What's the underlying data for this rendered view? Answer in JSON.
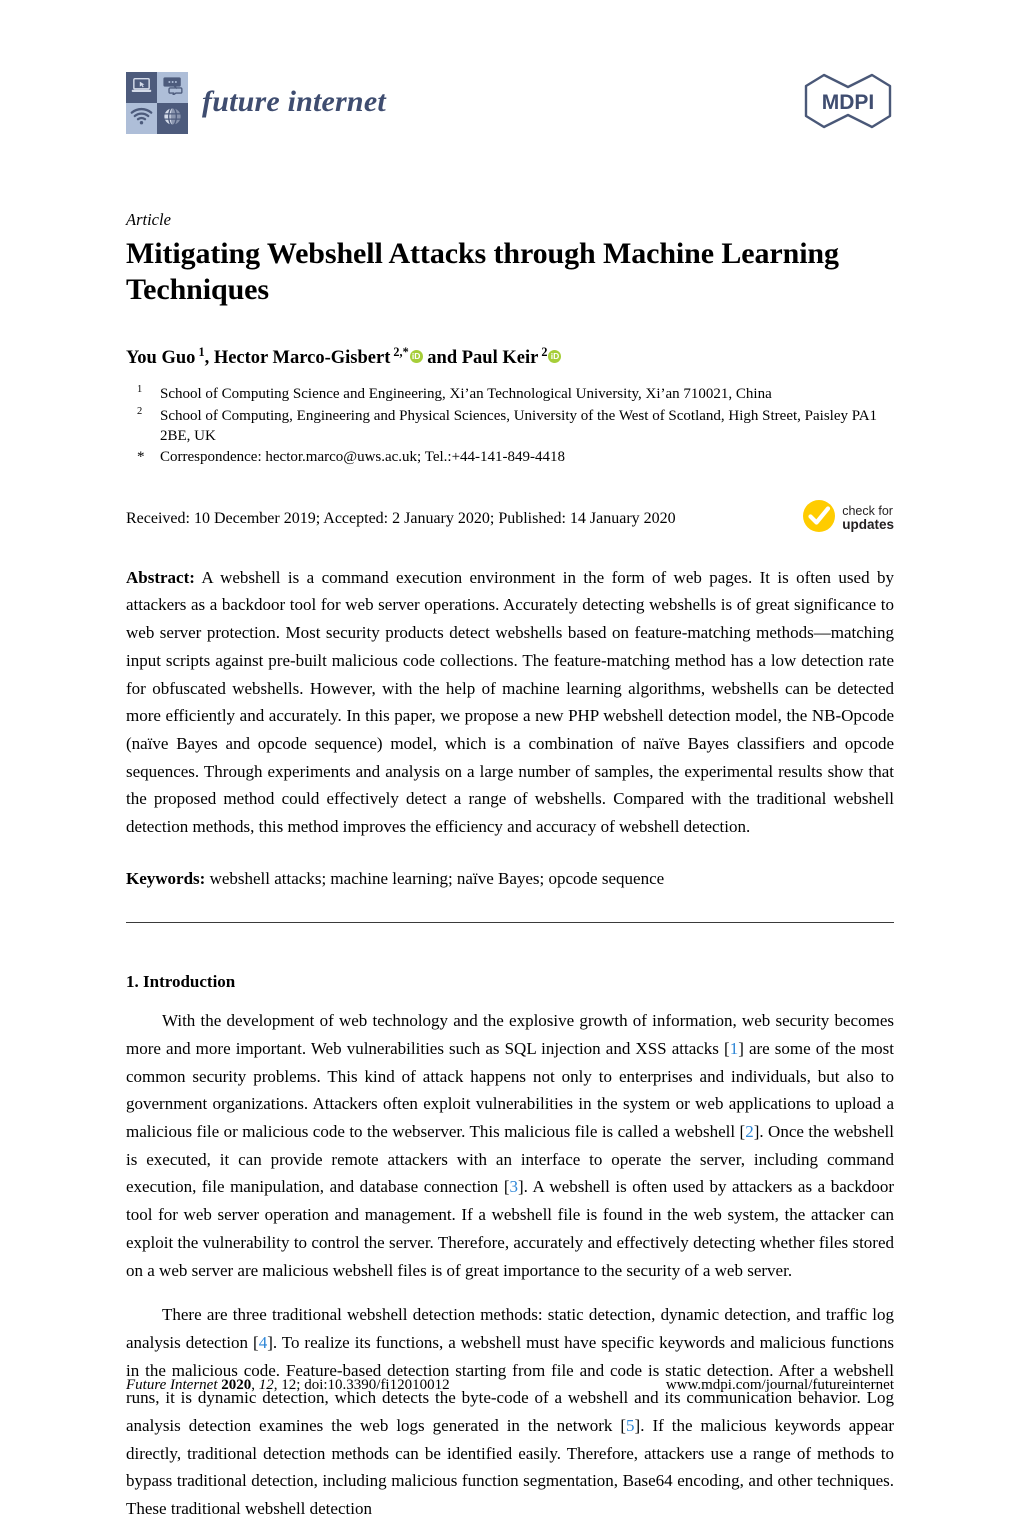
{
  "masthead": {
    "journal_name": "future internet",
    "publisher_logo_text": "MDPI",
    "logo_cells": [
      {
        "icon": "laptop-icon",
        "tone": "dark"
      },
      {
        "icon": "chat-bubbles-icon",
        "tone": "light"
      },
      {
        "icon": "wifi-icon",
        "tone": "light"
      },
      {
        "icon": "globe-icon",
        "tone": "dark"
      }
    ],
    "brand_color": "#3f4d70",
    "logo_dark": "#4d5b7c",
    "logo_light": "#aebed8"
  },
  "article": {
    "type": "Article",
    "title": "Mitigating Webshell Attacks through Machine Learning Techniques",
    "authors_html": "You Guo 1, Hector Marco-Gisbert 2,* and Paul Keir 2",
    "authors": [
      {
        "name": "You Guo",
        "marks": "1",
        "orcid": false
      },
      {
        "name": "Hector Marco-Gisbert",
        "marks": "2,*",
        "orcid": true
      },
      {
        "name": "Paul Keir",
        "marks": "2",
        "orcid": true
      }
    ],
    "orcid_glyph": "iD",
    "orcid_color": "#a6ce39",
    "affiliations": [
      {
        "marker": "1",
        "text": "School of Computing Science and Engineering, Xi’an Technological University, Xi’an 710021, China"
      },
      {
        "marker": "2",
        "text": "School of Computing, Engineering and Physical Sciences, University of the West of Scotland, High Street, Paisley PA1 2BE, UK"
      }
    ],
    "correspondence": {
      "marker": "*",
      "text": "Correspondence: hector.marco@uws.ac.uk; Tel.:+44-141-849-4418"
    },
    "dates": "Received: 10 December 2019; Accepted: 2 January 2020; Published: 14 January 2020"
  },
  "crossmark": {
    "line1": "check for",
    "line2": "updates",
    "tick_color": "#ffcc00"
  },
  "abstract": {
    "label": "Abstract:",
    "text": "A webshell is a command execution environment in the form of web pages. It is often used by attackers as a backdoor tool for web server operations. Accurately detecting webshells is of great significance to web server protection. Most security products detect webshells based on feature-matching methods—matching input scripts against pre-built malicious code collections. The feature-matching method has a low detection rate for obfuscated webshells. However, with the help of machine learning algorithms, webshells can be detected more efficiently and accurately. In this paper, we propose a new PHP webshell detection model, the NB-Opcode (naïve Bayes and opcode sequence) model, which is a combination of naïve Bayes classifiers and opcode sequences. Through experiments and analysis on a large number of samples, the experimental results show that the proposed method could effectively detect a range of webshells. Compared with the traditional webshell detection methods, this method improves the efficiency and accuracy of webshell detection."
  },
  "keywords": {
    "label": "Keywords:",
    "text": "webshell attacks; machine learning; naïve Bayes; opcode sequence"
  },
  "sections": [
    {
      "heading": "1. Introduction",
      "paragraphs": [
        {
          "indent": true,
          "runs": [
            {
              "t": "With the development of web technology and the explosive growth of information, web security becomes more and more important. Web vulnerabilities such as SQL injection and XSS attacks ["
            },
            {
              "t": "1",
              "cite": true
            },
            {
              "t": "] are some of the most common security problems. This kind of attack happens not only to enterprises and individuals, but also to government organizations. Attackers often exploit vulnerabilities in the system or web applications to upload a malicious file or malicious code to the webserver. This malicious file is called a webshell ["
            },
            {
              "t": "2",
              "cite": true
            },
            {
              "t": "]. Once the webshell is executed, it can provide remote attackers with an interface to operate the server, including command execution, file manipulation, and database connection ["
            },
            {
              "t": "3",
              "cite": true
            },
            {
              "t": "]. A webshell is often used by attackers as a backdoor tool for web server operation and management. If a webshell file is found in the web system, the attacker can exploit the vulnerability to control the server. Therefore, accurately and effectively detecting whether files stored on a web server are malicious webshell files is of great importance to the security of a web server."
            }
          ]
        },
        {
          "indent": true,
          "runs": [
            {
              "t": "There are three traditional webshell detection methods: static detection, dynamic detection, and traffic log analysis detection ["
            },
            {
              "t": "4",
              "cite": true
            },
            {
              "t": "]. To realize its functions, a webshell must have specific keywords and malicious functions in the malicious code. Feature-based detection starting from file and code is static detection. After a webshell runs, it is dynamic detection, which detects the byte-code of a webshell and its communication behavior. Log analysis detection examines the web logs generated in the network ["
            },
            {
              "t": "5",
              "cite": true
            },
            {
              "t": "]. If the malicious keywords appear directly, traditional detection methods can be identified easily. Therefore, attackers use a range of methods to bypass traditional detection, including malicious function segmentation, Base64 encoding, and other techniques. These traditional webshell detection"
            }
          ]
        }
      ]
    }
  ],
  "footer": {
    "journal": "Future Internet",
    "year": "2020",
    "volume": "12",
    "issue": "12",
    "doi": "doi:10.3390/fi12010012",
    "left_full": "Future Internet 2020, 12, 12; doi:10.3390/fi12010012",
    "url": "www.mdpi.com/journal/futureinternet"
  },
  "colors": {
    "citation_link": "#2e86d6",
    "rule": "#3a3a3a"
  }
}
